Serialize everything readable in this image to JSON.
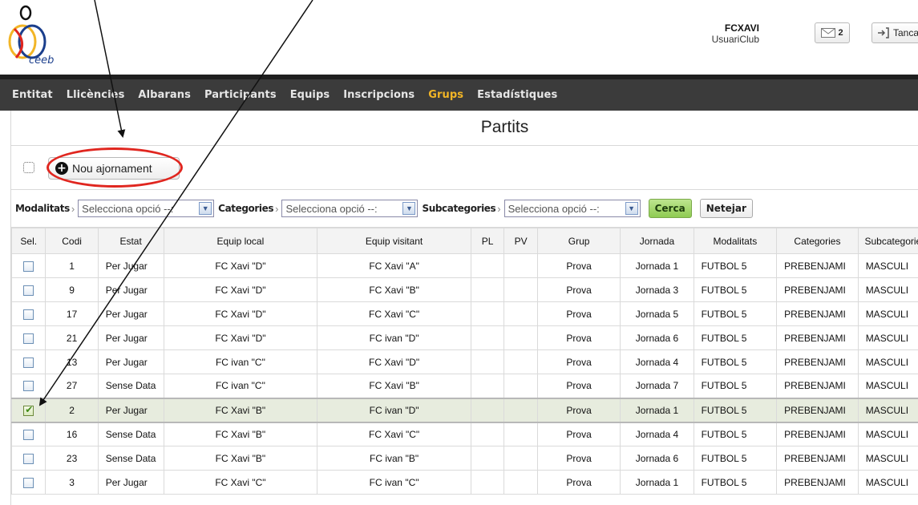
{
  "header": {
    "logo_text": "ceeb",
    "user_name": "FCXAVI",
    "user_role": "UsuariClub",
    "messages_count": "2",
    "logout_label": "Tancar"
  },
  "nav": {
    "items": [
      {
        "label": "Entitat",
        "active": false
      },
      {
        "label": "Llicències",
        "active": false
      },
      {
        "label": "Albarans",
        "active": false
      },
      {
        "label": "Participants",
        "active": false
      },
      {
        "label": "Equips",
        "active": false
      },
      {
        "label": "Inscripcions",
        "active": false
      },
      {
        "label": "Grups",
        "active": true
      },
      {
        "label": "Estadístiques",
        "active": false
      }
    ]
  },
  "page": {
    "title": "Partits",
    "new_button_label": "Nou ajornament"
  },
  "filters": {
    "modalitats_label": "Modalitats",
    "categories_label": "Categories",
    "subcategories_label": "Subcategories",
    "select_placeholder": "Selecciona opció --:",
    "search_label": "Cerca",
    "clear_label": "Netejar"
  },
  "table": {
    "columns": [
      "Sel.",
      "Codi",
      "Estat",
      "Equip local",
      "Equip visitant",
      "PL",
      "PV",
      "Grup",
      "Jornada",
      "Modalitats",
      "Categories",
      "Subcategories"
    ],
    "rows": [
      {
        "checked": false,
        "codi": "1",
        "estat": "Per Jugar",
        "local": "FC Xavi \"D\"",
        "visitant": "FC Xavi \"A\"",
        "pl": "",
        "pv": "",
        "grup": "Prova",
        "jornada": "Jornada 1",
        "modalitat": "FUTBOL 5",
        "categoria": "PREBENJAMI",
        "subcategoria": "MASCULI"
      },
      {
        "checked": false,
        "codi": "9",
        "estat": "Per Jugar",
        "local": "FC Xavi \"D\"",
        "visitant": "FC Xavi \"B\"",
        "pl": "",
        "pv": "",
        "grup": "Prova",
        "jornada": "Jornada 3",
        "modalitat": "FUTBOL 5",
        "categoria": "PREBENJAMI",
        "subcategoria": "MASCULI"
      },
      {
        "checked": false,
        "codi": "17",
        "estat": "Per Jugar",
        "local": "FC Xavi \"D\"",
        "visitant": "FC Xavi \"C\"",
        "pl": "",
        "pv": "",
        "grup": "Prova",
        "jornada": "Jornada 5",
        "modalitat": "FUTBOL 5",
        "categoria": "PREBENJAMI",
        "subcategoria": "MASCULI"
      },
      {
        "checked": false,
        "codi": "21",
        "estat": "Per Jugar",
        "local": "FC Xavi \"D\"",
        "visitant": "FC ivan \"D\"",
        "pl": "",
        "pv": "",
        "grup": "Prova",
        "jornada": "Jornada 6",
        "modalitat": "FUTBOL 5",
        "categoria": "PREBENJAMI",
        "subcategoria": "MASCULI"
      },
      {
        "checked": false,
        "codi": "13",
        "estat": "Per Jugar",
        "local": "FC ivan \"C\"",
        "visitant": "FC Xavi \"D\"",
        "pl": "",
        "pv": "",
        "grup": "Prova",
        "jornada": "Jornada 4",
        "modalitat": "FUTBOL 5",
        "categoria": "PREBENJAMI",
        "subcategoria": "MASCULI"
      },
      {
        "checked": false,
        "codi": "27",
        "estat": "Sense Data",
        "local": "FC ivan \"C\"",
        "visitant": "FC Xavi \"B\"",
        "pl": "",
        "pv": "",
        "grup": "Prova",
        "jornada": "Jornada 7",
        "modalitat": "FUTBOL 5",
        "categoria": "PREBENJAMI",
        "subcategoria": "MASCULI"
      },
      {
        "checked": true,
        "codi": "2",
        "estat": "Per Jugar",
        "local": "FC Xavi \"B\"",
        "visitant": "FC ivan \"D\"",
        "pl": "",
        "pv": "",
        "grup": "Prova",
        "jornada": "Jornada 1",
        "modalitat": "FUTBOL 5",
        "categoria": "PREBENJAMI",
        "subcategoria": "MASCULI"
      },
      {
        "checked": false,
        "codi": "16",
        "estat": "Sense Data",
        "local": "FC Xavi \"B\"",
        "visitant": "FC Xavi \"C\"",
        "pl": "",
        "pv": "",
        "grup": "Prova",
        "jornada": "Jornada 4",
        "modalitat": "FUTBOL 5",
        "categoria": "PREBENJAMI",
        "subcategoria": "MASCULI"
      },
      {
        "checked": false,
        "codi": "23",
        "estat": "Sense Data",
        "local": "FC Xavi \"B\"",
        "visitant": "FC ivan \"B\"",
        "pl": "",
        "pv": "",
        "grup": "Prova",
        "jornada": "Jornada 6",
        "modalitat": "FUTBOL 5",
        "categoria": "PREBENJAMI",
        "subcategoria": "MASCULI"
      },
      {
        "checked": false,
        "codi": "3",
        "estat": "Per Jugar",
        "local": "FC Xavi \"C\"",
        "visitant": "FC ivan \"C\"",
        "pl": "",
        "pv": "",
        "grup": "Prova",
        "jornada": "Jornada 1",
        "modalitat": "FUTBOL 5",
        "categoria": "PREBENJAMI",
        "subcategoria": "MASCULI"
      }
    ]
  },
  "colors": {
    "nav_background": "#3b3b3b",
    "nav_active": "#f2b526",
    "annotation_red": "#e0261f",
    "selected_row": "#e7ecde",
    "search_green": "#8fcb52"
  }
}
